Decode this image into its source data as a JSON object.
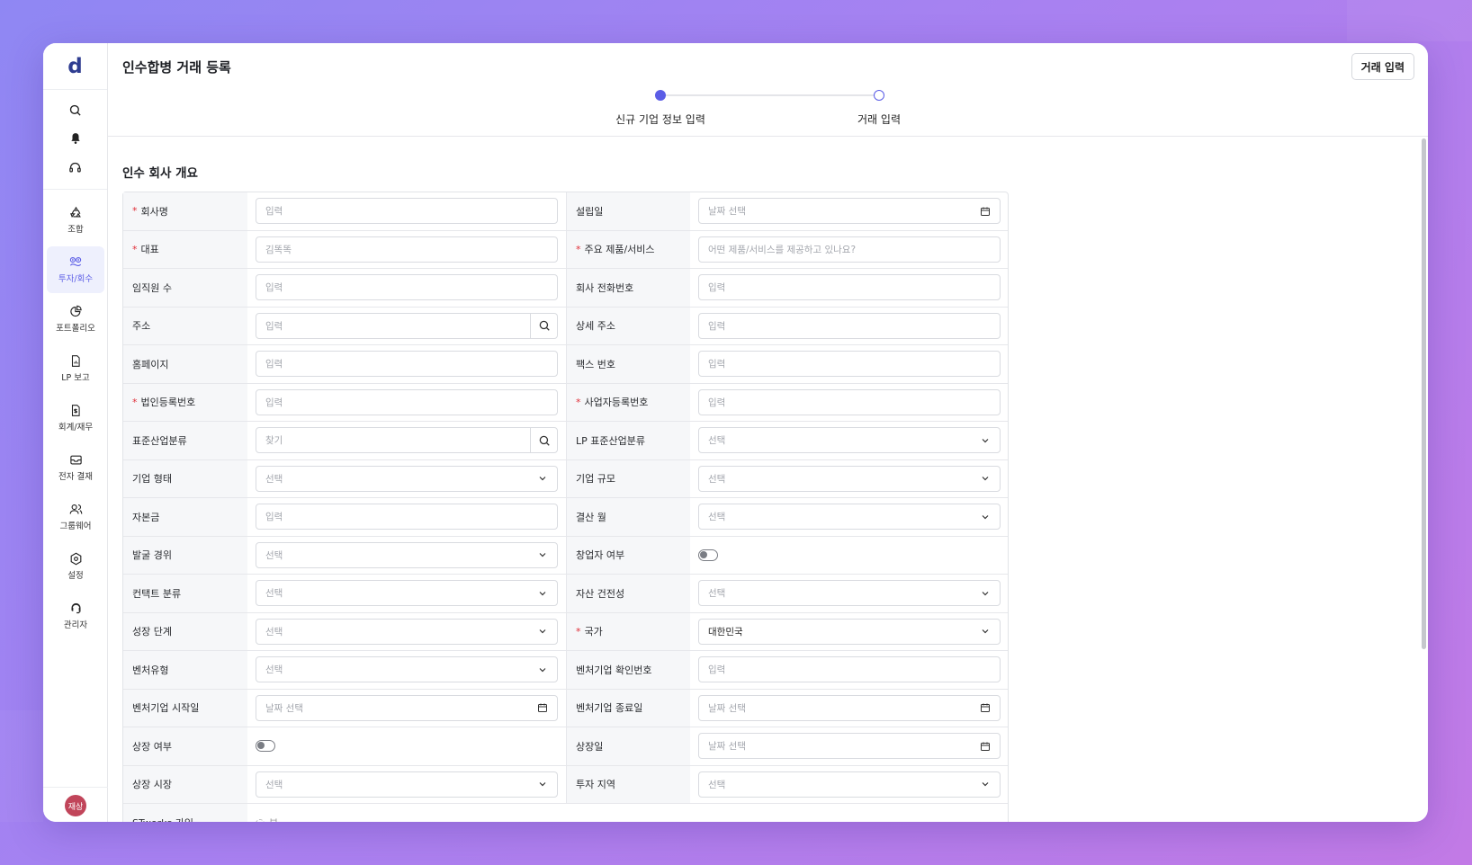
{
  "app": {
    "logo": "d",
    "page_title": "인수합병 거래 등록",
    "deal_button": "거래 입력"
  },
  "sidebar": {
    "top_icons": [
      "search-icon",
      "bell-icon",
      "headset-icon"
    ],
    "items": [
      {
        "label": "조합",
        "icon": "recycle-icon",
        "active": false
      },
      {
        "label": "투자/회수",
        "icon": "investment-icon",
        "active": true
      },
      {
        "label": "포트폴리오",
        "icon": "pie-chart-icon",
        "active": false
      },
      {
        "label": "LP 보고",
        "icon": "report-icon",
        "active": false
      },
      {
        "label": "회계/재무",
        "icon": "finance-doc-icon",
        "active": false
      },
      {
        "label": "전자 결재",
        "icon": "inbox-icon",
        "active": false
      },
      {
        "label": "그룹웨어",
        "icon": "users-icon",
        "active": false
      },
      {
        "label": "설정",
        "icon": "settings-icon",
        "active": false
      },
      {
        "label": "관리자",
        "icon": "admin-icon",
        "active": false
      }
    ],
    "avatar": "재상"
  },
  "stepper": {
    "steps": [
      {
        "label": "신규 기업 정보 입력",
        "state": "current"
      },
      {
        "label": "거래 입력",
        "state": "upcoming"
      }
    ]
  },
  "section": {
    "title": "인수 회사 개요"
  },
  "form": {
    "rows": [
      [
        {
          "label": "회사명",
          "required": true,
          "type": "text",
          "placeholder": "입력"
        },
        {
          "label": "설립일",
          "required": false,
          "type": "date",
          "placeholder": "날짜 선택"
        }
      ],
      [
        {
          "label": "대표",
          "required": true,
          "type": "text",
          "placeholder": "김똑똑"
        },
        {
          "label": "주요 제품/서비스",
          "required": true,
          "type": "text",
          "placeholder": "어떤 제품/서비스를 제공하고 있나요?"
        }
      ],
      [
        {
          "label": "임직원 수",
          "required": false,
          "type": "text",
          "placeholder": "입력"
        },
        {
          "label": "회사 전화번호",
          "required": false,
          "type": "text",
          "placeholder": "입력"
        }
      ],
      [
        {
          "label": "주소",
          "required": false,
          "type": "search",
          "placeholder": "입력"
        },
        {
          "label": "상세 주소",
          "required": false,
          "type": "text",
          "placeholder": "입력"
        }
      ],
      [
        {
          "label": "홈페이지",
          "required": false,
          "type": "text",
          "placeholder": "입력"
        },
        {
          "label": "팩스 번호",
          "required": false,
          "type": "text",
          "placeholder": "입력"
        }
      ],
      [
        {
          "label": "법인등록번호",
          "required": true,
          "type": "text",
          "placeholder": "입력"
        },
        {
          "label": "사업자등록번호",
          "required": true,
          "type": "text",
          "placeholder": "입력"
        }
      ],
      [
        {
          "label": "표준산업분류",
          "required": false,
          "type": "search",
          "placeholder": "찾기"
        },
        {
          "label": "LP 표준산업분류",
          "required": false,
          "type": "select",
          "placeholder": "선택"
        }
      ],
      [
        {
          "label": "기업 형태",
          "required": false,
          "type": "select",
          "placeholder": "선택"
        },
        {
          "label": "기업 규모",
          "required": false,
          "type": "select",
          "placeholder": "선택"
        }
      ],
      [
        {
          "label": "자본금",
          "required": false,
          "type": "text",
          "placeholder": "입력"
        },
        {
          "label": "결산 월",
          "required": false,
          "type": "select",
          "placeholder": "선택"
        }
      ],
      [
        {
          "label": "발굴 경위",
          "required": false,
          "type": "select",
          "placeholder": "선택"
        },
        {
          "label": "창업자 여부",
          "required": false,
          "type": "toggle",
          "placeholder": ""
        }
      ],
      [
        {
          "label": "컨택트 분류",
          "required": false,
          "type": "select",
          "placeholder": "선택"
        },
        {
          "label": "자산 건전성",
          "required": false,
          "type": "select",
          "placeholder": "선택"
        }
      ],
      [
        {
          "label": "성장 단계",
          "required": false,
          "type": "select",
          "placeholder": "선택"
        },
        {
          "label": "국가",
          "required": true,
          "type": "select",
          "placeholder": "",
          "value": "대한민국"
        }
      ],
      [
        {
          "label": "벤처유형",
          "required": false,
          "type": "select",
          "placeholder": "선택"
        },
        {
          "label": "벤처기업 확인번호",
          "required": false,
          "type": "text",
          "placeholder": "입력"
        }
      ],
      [
        {
          "label": "벤처기업 시작일",
          "required": false,
          "type": "date",
          "placeholder": "날짜 선택"
        },
        {
          "label": "벤처기업 종료일",
          "required": false,
          "type": "date",
          "placeholder": "날짜 선택"
        }
      ],
      [
        {
          "label": "상장 여부",
          "required": false,
          "type": "toggle",
          "placeholder": ""
        },
        {
          "label": "상장일",
          "required": false,
          "type": "date",
          "placeholder": "날짜 선택"
        }
      ],
      [
        {
          "label": "상장 시장",
          "required": false,
          "type": "select",
          "placeholder": "선택"
        },
        {
          "label": "투자 지역",
          "required": false,
          "type": "select",
          "placeholder": "선택"
        }
      ]
    ],
    "partial_row": {
      "label": "STworks 가입",
      "value": "부"
    }
  },
  "colors": {
    "accent": "#5b5de6",
    "required": "#e0303a",
    "label_bg": "#f6f7f9",
    "avatar": "#c1455a"
  }
}
